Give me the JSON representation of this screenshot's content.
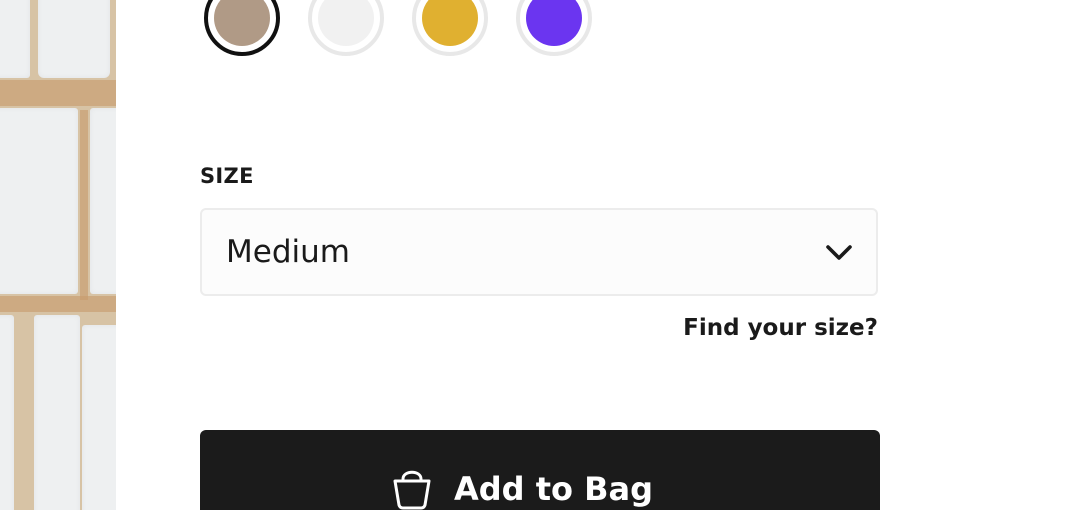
{
  "product": {
    "colors": {
      "options": [
        {
          "name": "taupe",
          "hex": "#b09a86",
          "selected": true
        },
        {
          "name": "light-gray",
          "hex": "#f1f1f1",
          "selected": false
        },
        {
          "name": "mustard",
          "hex": "#e0b030",
          "selected": false
        },
        {
          "name": "violet",
          "hex": "#6b35f0",
          "selected": false
        }
      ]
    },
    "size": {
      "label": "SIZE",
      "selected_value": "Medium",
      "find_size_link": "Find your size?"
    },
    "add_to_bag": {
      "label": "Add to Bag",
      "icon": "bag-icon"
    }
  },
  "theme": {
    "button_bg": "#1b1b1b",
    "text": "#1a1a1a",
    "select_border": "#ececec"
  }
}
